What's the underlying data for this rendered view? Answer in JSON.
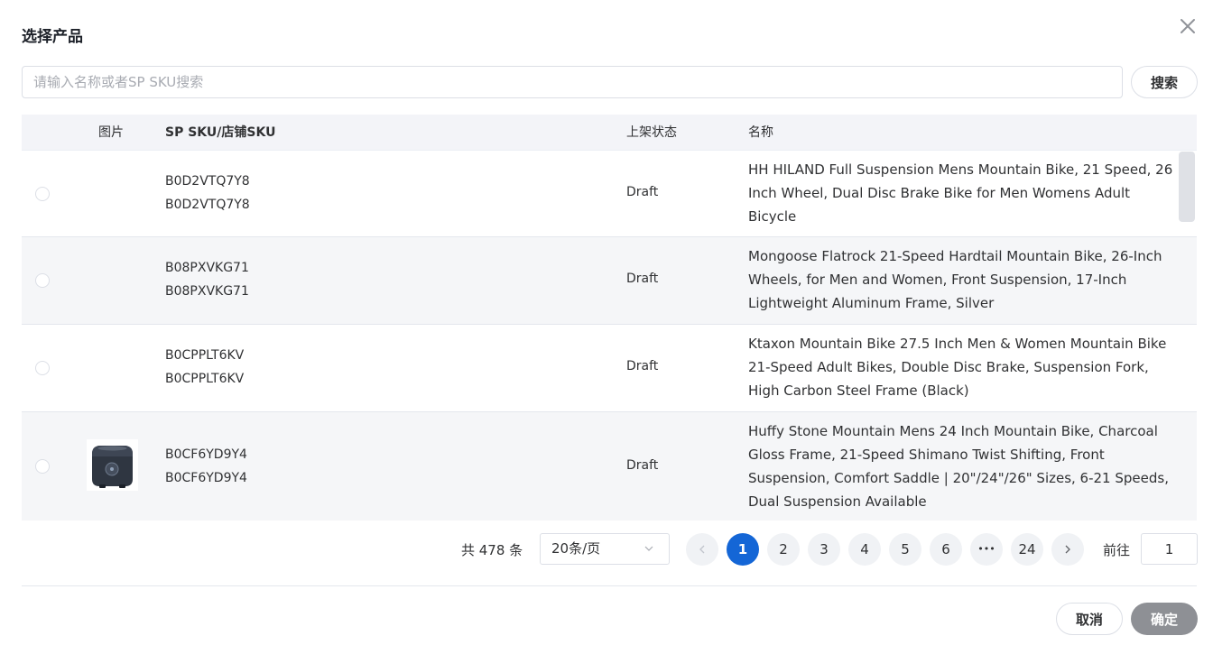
{
  "dialog": {
    "title": "选择产品",
    "close_icon": "close-icon"
  },
  "search": {
    "placeholder": "请输入名称或者SP SKU搜索",
    "value": "",
    "button_label": "搜索"
  },
  "table": {
    "columns": {
      "image": "图片",
      "sku": "SP SKU/店铺SKU",
      "status": "上架状态",
      "name": "名称"
    },
    "rows": [
      {
        "sp_sku": "B0D2VTQ7Y8",
        "store_sku": "B0D2VTQ7Y8",
        "status": "Draft",
        "name": "HH HILAND Full Suspension Mens Mountain Bike, 21 Speed, 26 Inch Wheel, Dual Disc Brake Bike for Men Womens Adult Bicycle",
        "has_image": false
      },
      {
        "sp_sku": "B08PXVKG71",
        "store_sku": "B08PXVKG71",
        "status": "Draft",
        "name": "Mongoose Flatrock 21-Speed Hardtail Mountain Bike, 26-Inch Wheels, for Men and Women, Front Suspension, 17-Inch Lightweight Aluminum Frame, Silver",
        "has_image": false
      },
      {
        "sp_sku": "B0CPPLT6KV",
        "store_sku": "B0CPPLT6KV",
        "status": "Draft",
        "name": "Ktaxon Mountain Bike 27.5 Inch Men & Women Mountain Bike 21-Speed Adult Bikes, Double Disc Brake, Suspension Fork, High Carbon Steel Frame (Black)",
        "has_image": false
      },
      {
        "sp_sku": "B0CF6YD9Y4",
        "store_sku": "B0CF6YD9Y4",
        "status": "Draft",
        "name": "Huffy Stone Mountain Mens 24 Inch Mountain Bike, Charcoal Gloss Frame, 21-Speed Shimano Twist Shifting, Front Suspension, Comfort Saddle | 20\"/24\"/26\" Sizes, 6-21 Speeds, Dual Suspension Available",
        "has_image": true,
        "image_icon": "rice-cooker-product-image"
      }
    ]
  },
  "pagination": {
    "total": "共 478 条",
    "page_size": "20条/页",
    "pages": [
      "1",
      "2",
      "3",
      "4",
      "5",
      "6",
      "•••",
      "24"
    ],
    "current_page": "1",
    "prev_icon": "chevron-left-icon",
    "next_icon": "chevron-right-icon",
    "goto_label": "前往",
    "goto_value": "1"
  },
  "footer": {
    "cancel_label": "取消",
    "confirm_label": "确定"
  },
  "colors": {
    "accent": "#1466d6",
    "confirm_disabled": "#8e9095",
    "header_bg": "#f3f4f8"
  }
}
